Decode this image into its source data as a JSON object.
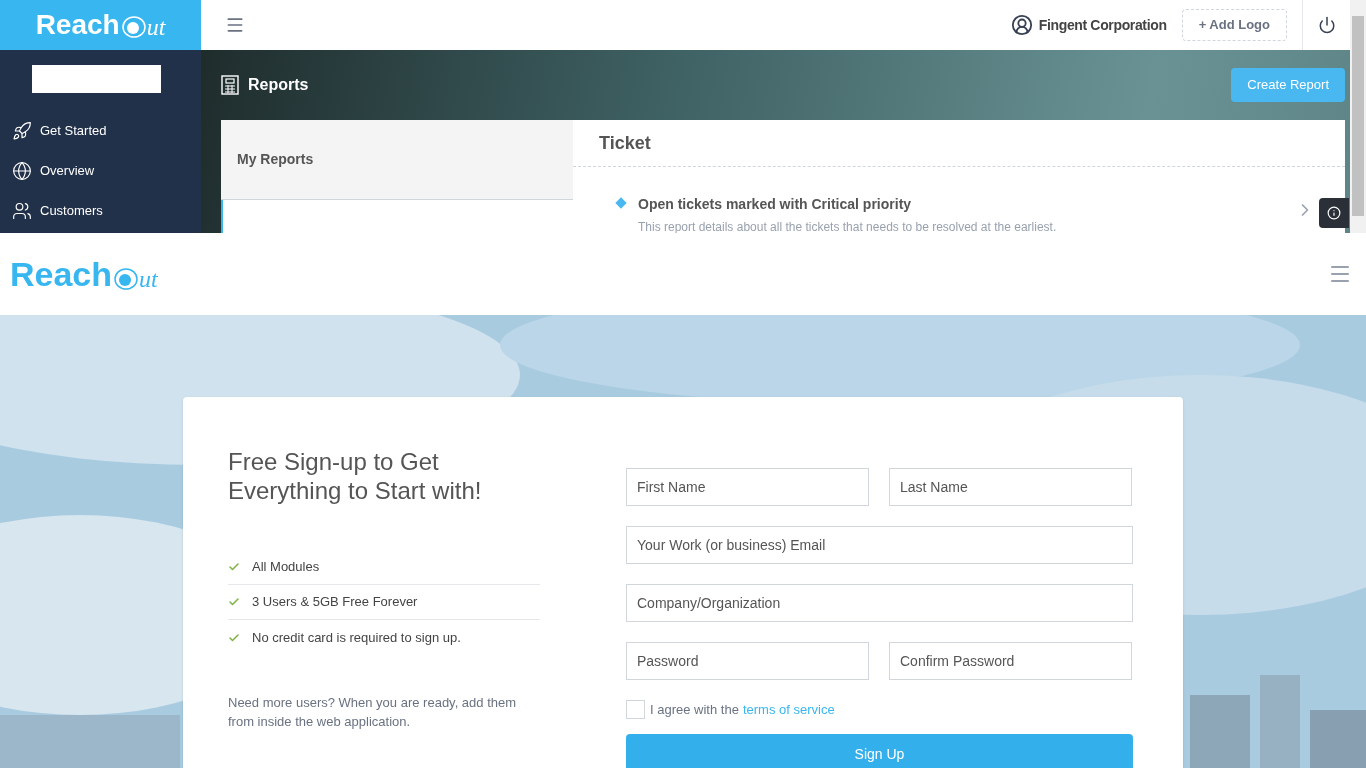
{
  "app": {
    "header": {
      "logo": {
        "main": "Reach",
        "script": "ut"
      },
      "company": "Fingent Corporation",
      "add_logo": "+ Add Logo"
    },
    "sidebar": {
      "items": [
        {
          "label": "Get Started"
        },
        {
          "label": "Overview"
        },
        {
          "label": "Customers"
        }
      ]
    },
    "page_title": "Reports",
    "create_button": "Create Report",
    "left_panel": {
      "title": "My Reports"
    },
    "section": {
      "title": "Ticket",
      "items": [
        {
          "title": "Open tickets marked with Critical priority",
          "description": "This report details about all the tickets that needs to be resolved at the earliest."
        }
      ]
    }
  },
  "signup": {
    "logo": {
      "main": "Reach",
      "script": "ut"
    },
    "heading": "Free Sign-up to Get Everything to Start with!",
    "features": [
      "All Modules",
      "3 Users & 5GB Free Forever",
      "No credit card is required to sign up."
    ],
    "note": "Need more users? When you are ready, add them from inside the web application.",
    "fields": [
      {
        "placeholder": "First Name"
      },
      {
        "placeholder": "Last Name"
      },
      {
        "placeholder": "Your Work (or business) Email"
      },
      {
        "placeholder": "Company/Organization"
      },
      {
        "placeholder": "Password"
      },
      {
        "placeholder": "Confirm Password"
      }
    ],
    "agree": {
      "checked": false,
      "text": "I agree with the",
      "link": "terms of service"
    },
    "submit": "Sign Up"
  }
}
